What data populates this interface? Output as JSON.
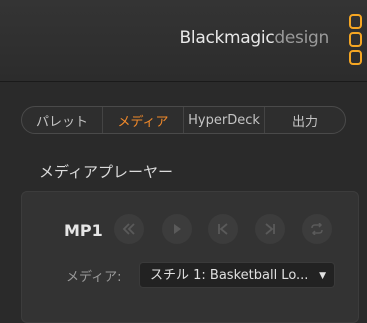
{
  "header": {
    "brand_main": "Blackmagic",
    "brand_sub": "design"
  },
  "tabs": [
    {
      "label": "パレット",
      "active": false
    },
    {
      "label": "メディア",
      "active": true
    },
    {
      "label": "HyperDeck",
      "active": false
    },
    {
      "label": "出力",
      "active": false
    }
  ],
  "section": {
    "title": "メディアプレーヤー"
  },
  "player": {
    "name": "MP1",
    "controls": [
      "rewind-icon",
      "play-icon",
      "skip-to-start-icon",
      "skip-to-end-icon",
      "loop-icon"
    ],
    "media_label": "メディア:",
    "media_value": "スチル 1: Basketball Lo..."
  },
  "colors": {
    "accent": "#f0892a",
    "logo": "#f5a623"
  }
}
